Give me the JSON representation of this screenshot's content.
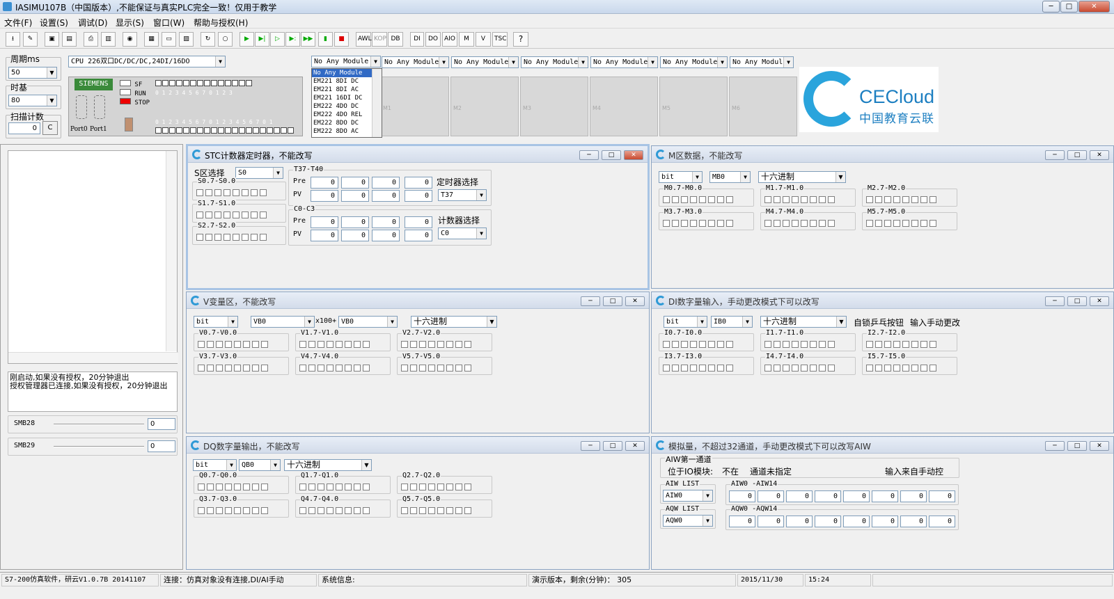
{
  "window": {
    "title": "IASIMU107B（中国版本）,不能保证与真实PLC完全一致！仅用于教学"
  },
  "menu": [
    "文件(F)",
    "设置(S)",
    "调试(D)",
    "显示(S)",
    "窗口(W)",
    "帮助与授权(H)"
  ],
  "toolbar": {
    "text_buttons": [
      "AWL",
      "KOP",
      "DB",
      "DI",
      "DO",
      "AIO",
      "M",
      "V",
      "TSC",
      "?"
    ]
  },
  "plc": {
    "period_label": "周期ms",
    "period_value": "50",
    "timebase_label": "时基",
    "timebase_value": "80",
    "scan_label": "扫描计数",
    "scan_value": "0",
    "scan_clear": "C",
    "cpu_select": "CPU 226双口DC/DC/DC,24DI/16DO",
    "brand": "SIEMENS",
    "led_sf": "SF",
    "led_run": "RUN",
    "led_stop": "STOP",
    "port0": "Port0",
    "port1": "Port1",
    "io_digits_top": "0 1 2 3 4 5 6 7 0 1 2 3",
    "io_digits_bottom": "0 1 2 3 4 5 6 7 0 1 2 3 4 5 6 7 0 1",
    "module_selects": [
      "No Any Module",
      "No Any Module",
      "No Any Module",
      "No Any Module",
      "No Any Module",
      "No Any Module",
      "No Any Modul"
    ],
    "slot_labels": [
      "M1",
      "M2",
      "M3",
      "M4",
      "M5",
      "M6",
      "M7"
    ],
    "dropdown_options": [
      "No Any Module",
      "EM221 8DI DC",
      "EM221 8DI AC",
      "EM221 16DI DC",
      "EM222 4DO DC",
      "EM222 4DO REL",
      "EM222 8DO DC",
      "EM222 8DO AC"
    ],
    "logo_text": "CECloud",
    "logo_sub": "中国教育云联"
  },
  "left": {
    "message": "刚启动,如果没有授权，20分钟退出\n授权管理器已连接,如果没有授权，20分钟退出",
    "smb28_label": "SMB28",
    "smb28_value": "0",
    "smb29_label": "SMB29",
    "smb29_value": "0"
  },
  "stc": {
    "title": "STC计数器定时器，不能改写",
    "s_label": "S区选择",
    "s_value": "S0",
    "s_groups": [
      "S0.7-S0.0",
      "S1.7-S1.0",
      "S2.7-S2.0"
    ],
    "timer_group": "T37-T40",
    "counter_group": "C0-C3",
    "pre": "Pre",
    "pv": "PV",
    "timer_pre": [
      "0",
      "0",
      "0",
      "0"
    ],
    "timer_pv": [
      "0",
      "0",
      "0",
      "0"
    ],
    "counter_pre": [
      "0",
      "0",
      "0",
      "0"
    ],
    "counter_pv": [
      "0",
      "0",
      "0",
      "0"
    ],
    "timer_sel_label": "定时器选择",
    "timer_sel": "T37",
    "counter_sel_label": "计数器选择",
    "counter_sel": "C0"
  },
  "mzone": {
    "title": "M区数据，不能改写",
    "sel1": "bit",
    "sel2": "MB0",
    "sel3": "十六进制",
    "groups": [
      "M0.7-M0.0",
      "M1.7-M1.0",
      "M2.7-M2.0",
      "M3.7-M3.0",
      "M4.7-M4.0",
      "M5.7-M5.0"
    ]
  },
  "vzone": {
    "title": "V变量区，不能改写",
    "sel1": "bit",
    "sel2": "VB0",
    "mult": "x100+",
    "sel3": "VB0",
    "sel4": "十六进制",
    "groups": [
      "V0.7-V0.0",
      "V1.7-V1.0",
      "V2.7-V2.0",
      "V3.7-V3.0",
      "V4.7-V4.0",
      "V5.7-V5.0"
    ]
  },
  "di": {
    "title": "DI数字量输入，手动更改模式下可以改写",
    "sel1": "bit",
    "sel2": "IB0",
    "sel3": "十六进制",
    "latch": "自锁乒乓按钮",
    "manual": "输入手动更改",
    "groups": [
      "I0.7-I0.0",
      "I1.7-I1.0",
      "I2.7-I2.0",
      "I3.7-I3.0",
      "I4.7-I4.0",
      "I5.7-I5.0"
    ]
  },
  "dq": {
    "title": "DQ数字量输出，不能改写",
    "sel1": "bit",
    "sel2": "QB0",
    "sel3": "十六进制",
    "groups": [
      "Q0.7-Q0.0",
      "Q1.7-Q1.0",
      "Q2.7-Q2.0",
      "Q3.7-Q3.0",
      "Q4.7-Q4.0",
      "Q5.7-Q5.0"
    ]
  },
  "analog": {
    "title": "模拟量，不超过32通道，手动更改模式下可以改写AIW",
    "ch_group": "AIW第一通道",
    "loc_label": "位于IO模块:",
    "loc_value": "不在",
    "ch_unassigned": "通道未指定",
    "input_from": "输入来自手动控",
    "aiw_list_label": "AIW LIST",
    "aiw_list": "AIW0",
    "aqw_list_label": "AQW LIST",
    "aqw_list": "AQW0",
    "aiw_range": "AIW0 -AIW14",
    "aqw_range": "AQW0 -AQW14",
    "aiw_values": [
      "0",
      "0",
      "0",
      "0",
      "0",
      "0",
      "0",
      "0"
    ],
    "aqw_values": [
      "0",
      "0",
      "0",
      "0",
      "0",
      "0",
      "0",
      "0"
    ]
  },
  "status": {
    "version": "S7-200仿真软件，研云V1.0.7B 20141107",
    "conn": "连接：仿真对象没有连接,DI/AI手动",
    "sys": "系统信息:",
    "demo": "演示版本，剩余(分钟)： 305",
    "date": "2015/11/30",
    "time": "15:24"
  }
}
